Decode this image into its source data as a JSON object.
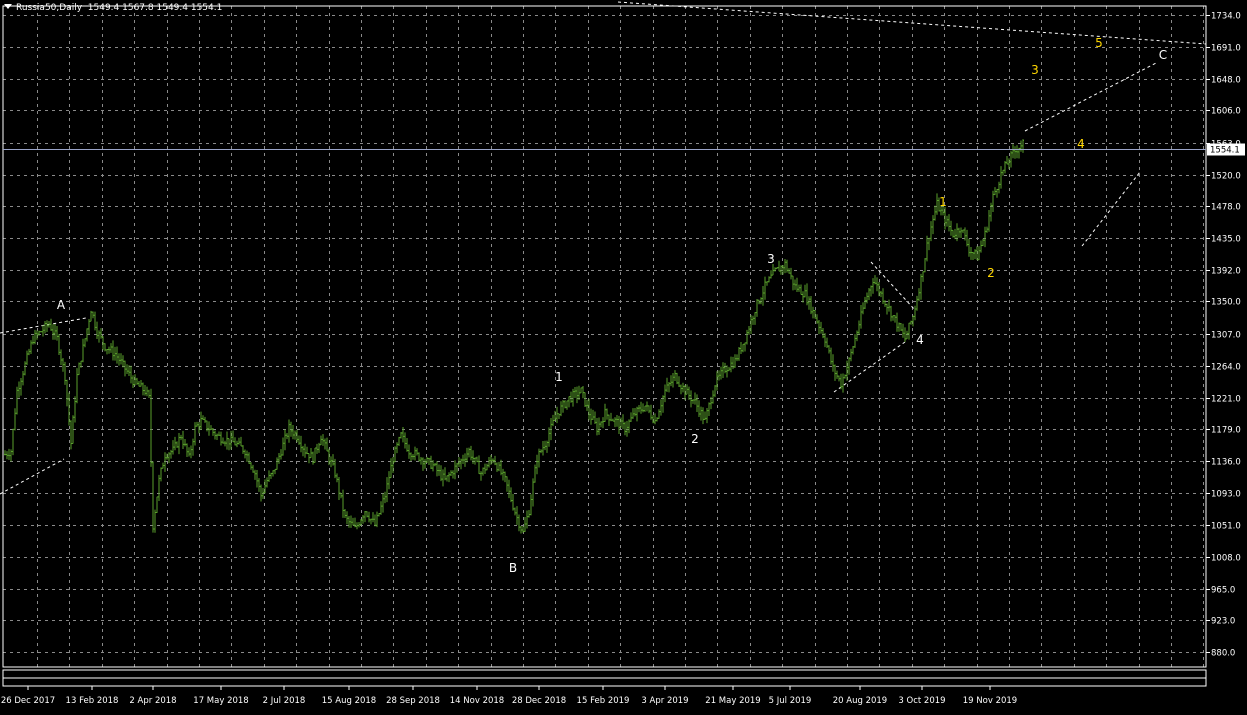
{
  "header": {
    "symbol": "Russia50,Daily",
    "ohlc": "1549.4 1567.8 1549.4 1554.1"
  },
  "price_label": "1554.1",
  "chart_data": {
    "type": "candlestick",
    "series_color": "#5aa02c",
    "ylim": [
      860,
      1746
    ],
    "yticks": [
      "1734.0",
      "1691.0",
      "1648.0",
      "1606.0",
      "1563.0",
      "1520.0",
      "1478.0",
      "1435.0",
      "1392.0",
      "1350.0",
      "1307.0",
      "1264.0",
      "1221.0",
      "1179.0",
      "1136.0",
      "1093.0",
      "1051.0",
      "1008.0",
      "965.0",
      "923.0",
      "880.0"
    ],
    "xticks": [
      "26 Dec 2017",
      "13 Feb 2018",
      "2 Apr 2018",
      "17 May 2018",
      "2 Jul 2018",
      "15 Aug 2018",
      "28 Sep 2018",
      "14 Nov 2018",
      "28 Dec 2018",
      "15 Feb 2019",
      "3 Apr 2019",
      "21 May 2019",
      "5 Jul 2019",
      "20 Aug 2019",
      "3 Oct 2019",
      "19 Nov 2019"
    ],
    "close_path": [
      [
        0,
        1145
      ],
      [
        3,
        1150
      ],
      [
        6,
        1230
      ],
      [
        10,
        1265
      ],
      [
        14,
        1300
      ],
      [
        18,
        1310
      ],
      [
        22,
        1320
      ],
      [
        26,
        1300
      ],
      [
        30,
        1250
      ],
      [
        33,
        1160
      ],
      [
        36,
        1250
      ],
      [
        40,
        1300
      ],
      [
        43,
        1340
      ],
      [
        46,
        1310
      ],
      [
        50,
        1290
      ],
      [
        55,
        1280
      ],
      [
        60,
        1260
      ],
      [
        65,
        1240
      ],
      [
        70,
        1230
      ],
      [
        72,
        1220
      ],
      [
        74,
        1050
      ],
      [
        77,
        1110
      ],
      [
        80,
        1145
      ],
      [
        84,
        1150
      ],
      [
        88,
        1170
      ],
      [
        92,
        1140
      ],
      [
        95,
        1180
      ],
      [
        98,
        1190
      ],
      [
        102,
        1180
      ],
      [
        106,
        1170
      ],
      [
        110,
        1165
      ],
      [
        115,
        1160
      ],
      [
        120,
        1150
      ],
      [
        125,
        1120
      ],
      [
        128,
        1090
      ],
      [
        131,
        1110
      ],
      [
        134,
        1120
      ],
      [
        138,
        1150
      ],
      [
        142,
        1180
      ],
      [
        146,
        1170
      ],
      [
        150,
        1150
      ],
      [
        154,
        1140
      ],
      [
        158,
        1170
      ],
      [
        162,
        1140
      ],
      [
        165,
        1120
      ],
      [
        170,
        1060
      ],
      [
        175,
        1045
      ],
      [
        180,
        1070
      ],
      [
        185,
        1050
      ],
      [
        190,
        1090
      ],
      [
        194,
        1140
      ],
      [
        198,
        1170
      ],
      [
        202,
        1150
      ],
      [
        208,
        1140
      ],
      [
        214,
        1130
      ],
      [
        220,
        1110
      ],
      [
        226,
        1130
      ],
      [
        232,
        1150
      ],
      [
        238,
        1120
      ],
      [
        244,
        1140
      ],
      [
        250,
        1110
      ],
      [
        256,
        1060
      ],
      [
        259,
        1040
      ],
      [
        262,
        1070
      ],
      [
        266,
        1140
      ],
      [
        270,
        1160
      ],
      [
        276,
        1200
      ],
      [
        282,
        1220
      ],
      [
        288,
        1230
      ],
      [
        292,
        1200
      ],
      [
        296,
        1180
      ],
      [
        300,
        1200
      ],
      [
        305,
        1190
      ],
      [
        310,
        1180
      ],
      [
        315,
        1200
      ],
      [
        320,
        1210
      ],
      [
        325,
        1190
      ],
      [
        330,
        1230
      ],
      [
        335,
        1250
      ],
      [
        340,
        1230
      ],
      [
        345,
        1215
      ],
      [
        350,
        1190
      ],
      [
        355,
        1240
      ],
      [
        360,
        1260
      ],
      [
        365,
        1270
      ],
      [
        370,
        1300
      ],
      [
        375,
        1340
      ],
      [
        380,
        1370
      ],
      [
        385,
        1390
      ],
      [
        390,
        1400
      ],
      [
        395,
        1370
      ],
      [
        400,
        1360
      ],
      [
        405,
        1330
      ],
      [
        410,
        1300
      ],
      [
        414,
        1260
      ],
      [
        418,
        1240
      ],
      [
        422,
        1270
      ],
      [
        426,
        1310
      ],
      [
        430,
        1350
      ],
      [
        434,
        1380
      ],
      [
        438,
        1360
      ],
      [
        442,
        1340
      ],
      [
        446,
        1320
      ],
      [
        450,
        1300
      ],
      [
        454,
        1330
      ],
      [
        458,
        1380
      ],
      [
        462,
        1440
      ],
      [
        466,
        1480
      ],
      [
        470,
        1460
      ],
      [
        474,
        1440
      ],
      [
        478,
        1450
      ],
      [
        482,
        1420
      ],
      [
        486,
        1410
      ],
      [
        490,
        1440
      ],
      [
        494,
        1490
      ],
      [
        498,
        1520
      ],
      [
        502,
        1540
      ],
      [
        506,
        1555
      ],
      [
        510,
        1565
      ]
    ],
    "waves": [
      {
        "label": "A",
        "color": "#ffffff"
      },
      {
        "label": "B",
        "color": "#ffffff"
      },
      {
        "label": "C",
        "color": "#ffffff"
      },
      {
        "label": "1",
        "color": "#ffffff"
      },
      {
        "label": "2",
        "color": "#ffffff"
      },
      {
        "label": "3",
        "color": "#ffffff"
      },
      {
        "label": "4",
        "color": "#ffffff"
      },
      {
        "label": "1",
        "color": "#ffd700"
      },
      {
        "label": "2",
        "color": "#ffd700"
      },
      {
        "label": "3",
        "color": "#ffd700"
      },
      {
        "label": "4",
        "color": "#ffd700"
      },
      {
        "label": "5",
        "color": "#ffd700"
      }
    ]
  }
}
